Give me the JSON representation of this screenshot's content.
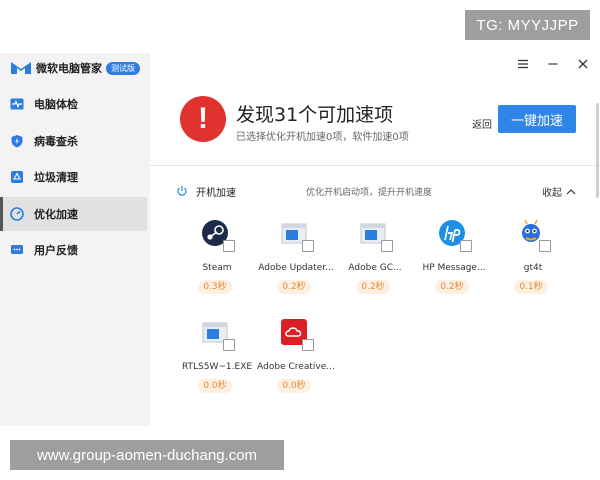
{
  "watermarks": {
    "top": "TG: MYYJJPP",
    "bottom": "www.group-aomen-duchang.com"
  },
  "app": {
    "name": "微软电脑管家",
    "badge": "测试版"
  },
  "sidebar": {
    "items": [
      {
        "label": "电脑体检",
        "icon": "pulse-icon"
      },
      {
        "label": "病毒查杀",
        "icon": "shield-icon"
      },
      {
        "label": "垃圾清理",
        "icon": "recycle-icon"
      },
      {
        "label": "优化加速",
        "icon": "speedometer-icon",
        "active": true
      },
      {
        "label": "用户反馈",
        "icon": "chat-icon"
      }
    ]
  },
  "header": {
    "title": "发现31个可加速项",
    "subtitle": "已选择优化开机加速0项，软件加速0项",
    "back_label": "返回",
    "primary_label": "一键加速",
    "accent_color": "#2f86e6",
    "warning_color": "#e0332f"
  },
  "startup": {
    "title": "开机加速",
    "desc": "优化开机启动项，提升开机速度",
    "collapse_label": "收起",
    "apps": [
      {
        "name": "Steam",
        "time": "0.3秒"
      },
      {
        "name": "Adobe Updater...",
        "time": "0.2秒"
      },
      {
        "name": "Adobe GC...",
        "time": "0.2秒"
      },
      {
        "name": "HP Message...",
        "time": "0.2秒"
      },
      {
        "name": "gt4t",
        "time": "0.1秒"
      },
      {
        "name": "RTLS5W~1.EXE",
        "time": "0.0秒"
      },
      {
        "name": "Adobe Creative...",
        "time": "0.0秒"
      }
    ]
  }
}
